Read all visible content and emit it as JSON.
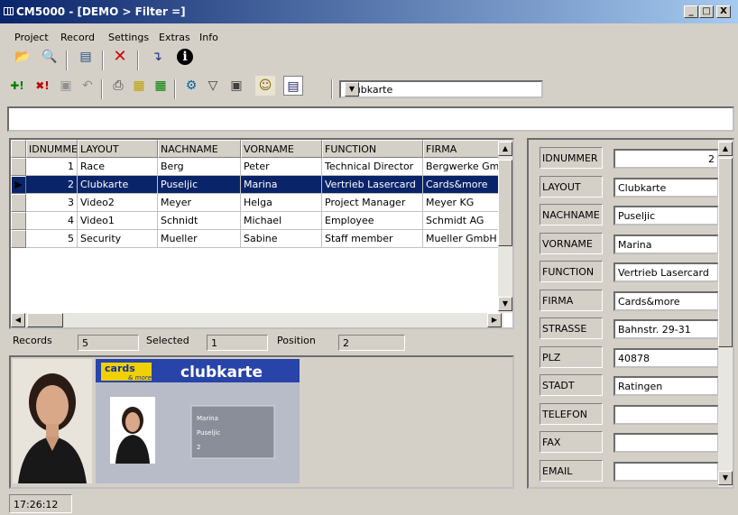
{
  "window": {
    "title": "CM5000 - [DEMO  > Filter =]",
    "min": "_",
    "max": "□",
    "close": "X"
  },
  "menu": [
    "Project",
    "Record",
    "Settings",
    "Extras",
    "Info"
  ],
  "toolbar2": {
    "combo_value": "Clubkarte"
  },
  "filter_text": "",
  "grid": {
    "columns": [
      "IDNUMMER",
      "LAYOUT",
      "NACHNAME",
      "VORNAME",
      "FUNCTION",
      "FIRMA"
    ],
    "rows": [
      {
        "id": "1",
        "layout": "Race",
        "nachname": "Berg",
        "vorname": "Peter",
        "function": "Technical Director",
        "firma": "Bergwerke GmbH"
      },
      {
        "id": "2",
        "layout": "Clubkarte",
        "nachname": "Puseljic",
        "vorname": "Marina",
        "function": "Vertrieb Lasercard",
        "firma": "Cards&more"
      },
      {
        "id": "3",
        "layout": "Video2",
        "nachname": "Meyer",
        "vorname": "Helga",
        "function": "Project Manager",
        "firma": "Meyer KG"
      },
      {
        "id": "4",
        "layout": "Video1",
        "nachname": "Schnidt",
        "vorname": "Michael",
        "function": "Employee",
        "firma": "Schmidt AG"
      },
      {
        "id": "5",
        "layout": "Security",
        "nachname": "Mueller",
        "vorname": "Sabine",
        "function": "Staff member",
        "firma": "Mueller GmbH"
      }
    ],
    "selected_index": 1
  },
  "status": {
    "records_label": "Records",
    "records_value": "5",
    "selected_label": "Selected",
    "selected_value": "1",
    "position_label": "Position",
    "position_value": "2"
  },
  "card": {
    "brand": "cards",
    "brand_sub": "& more",
    "title": "clubkarte",
    "name_first": "Marina",
    "name_last": "Puseljic",
    "number": "2"
  },
  "fields": [
    {
      "label": "IDNUMMER",
      "value": "2"
    },
    {
      "label": "LAYOUT",
      "value": "Clubkarte"
    },
    {
      "label": "NACHNAME",
      "value": "Puseljic"
    },
    {
      "label": "VORNAME",
      "value": "Marina"
    },
    {
      "label": "FUNCTION",
      "value": "Vertrieb Lasercard"
    },
    {
      "label": "FIRMA",
      "value": "Cards&more"
    },
    {
      "label": "STRASSE",
      "value": "Bahnstr. 29-31"
    },
    {
      "label": "PLZ",
      "value": "40878"
    },
    {
      "label": "STADT",
      "value": "Ratingen"
    },
    {
      "label": "TELEFON",
      "value": ""
    },
    {
      "label": "FAX",
      "value": ""
    },
    {
      "label": "EMAIL",
      "value": ""
    }
  ],
  "clock": "17:26:12",
  "colors": {
    "selection": "#0a246a",
    "title_gradient_start": "#0a246a",
    "title_gradient_end": "#a6caf0",
    "card_blue": "#1f3fa0"
  },
  "icons": [
    "open-folder-icon",
    "find-icon",
    "print-preview-icon",
    "delete-icon",
    "import-icon",
    "info-icon",
    "add-record-icon",
    "delete-record-icon",
    "save-icon",
    "undo-icon",
    "printer-icon",
    "card-print-icon",
    "card-batch-icon",
    "settings-icon",
    "filter-icon",
    "camera-icon",
    "person-icon",
    "preview-icon"
  ]
}
